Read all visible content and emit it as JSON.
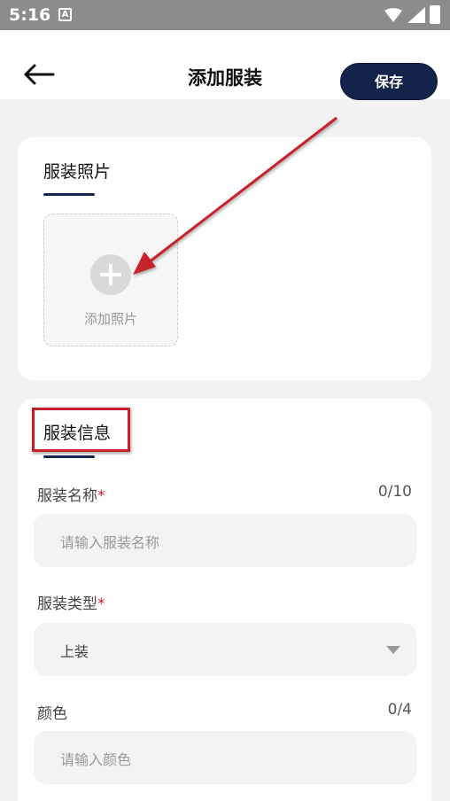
{
  "status_bar": {
    "time": "5:16",
    "notification_letter": "A"
  },
  "header": {
    "title": "添加服装",
    "save_label": "保存"
  },
  "photo_section": {
    "title": "服装照片",
    "add_label": "添加照片"
  },
  "info_section": {
    "title": "服装信息",
    "name_field": {
      "label": "服装名称",
      "required": "*",
      "count": "0/10",
      "placeholder": "请输入服装名称"
    },
    "type_field": {
      "label": "服装类型",
      "required": "*",
      "value": "上装"
    },
    "color_field": {
      "label": "颜色",
      "count": "0/4",
      "placeholder": "请输入颜色"
    }
  },
  "colors": {
    "accent": "#13234a",
    "required": "#d3202a",
    "annotation": "#c8202a"
  }
}
